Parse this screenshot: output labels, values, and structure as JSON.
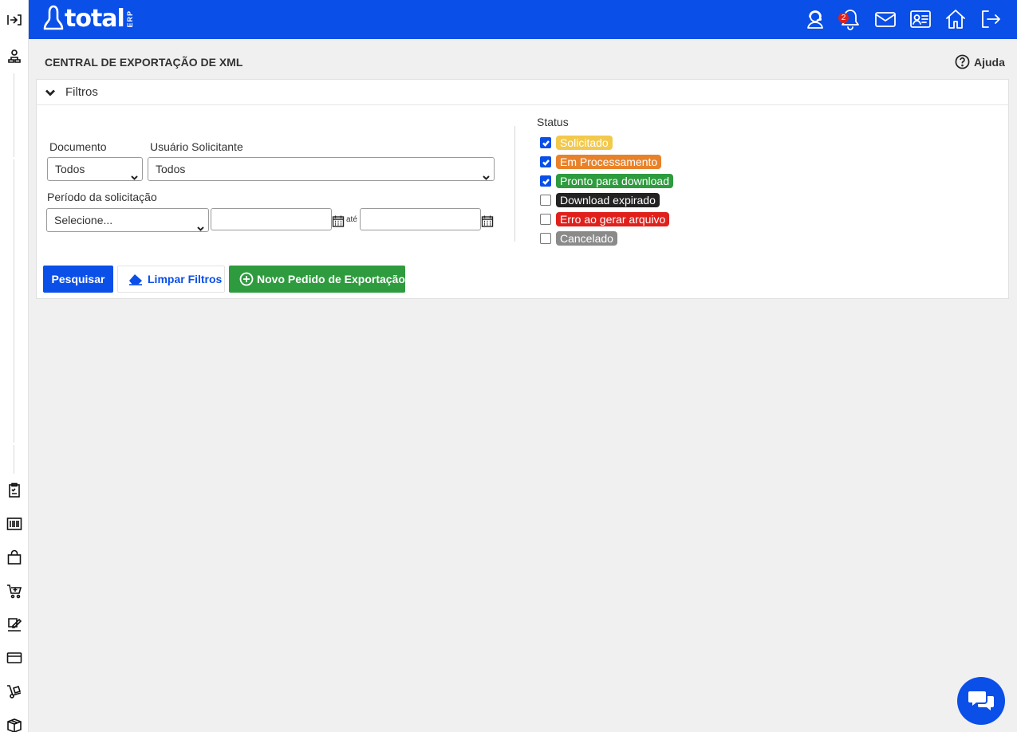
{
  "app": {
    "logo_text": "total",
    "logo_suffix": "ERP",
    "notification_count": "2"
  },
  "page": {
    "title": "CENTRAL DE EXPORTAÇÃO DE XML",
    "help_label": "Ajuda"
  },
  "filters": {
    "header": "Filtros",
    "documento_label": "Documento",
    "documento_value": "Todos",
    "usuario_label": "Usuário Solicitante",
    "usuario_value": "Todos",
    "periodo_label": "Período da solicitação",
    "periodo_value": "Selecione...",
    "date_from": "",
    "date_to": "",
    "ate_label": "até",
    "status_label": "Status",
    "status_options": [
      {
        "label": "Solicitado",
        "checked": true,
        "color": "#f2c94c"
      },
      {
        "label": "Em Processamento",
        "checked": true,
        "color": "#e8822a"
      },
      {
        "label": "Pronto para download",
        "checked": true,
        "color": "#2e9b3e"
      },
      {
        "label": "Download expirado",
        "checked": false,
        "color": "#222222"
      },
      {
        "label": "Erro ao gerar arquivo",
        "checked": false,
        "color": "#e0201b"
      },
      {
        "label": "Cancelado",
        "checked": false,
        "color": "#8a8a8a"
      }
    ]
  },
  "actions": {
    "search": "Pesquisar",
    "clear": "Limpar Filtros",
    "new_request": "Novo Pedido de Exportação"
  },
  "colors": {
    "brand": "#0a4fe8",
    "success": "#2e9b3e",
    "background": "#f0f0f0"
  }
}
